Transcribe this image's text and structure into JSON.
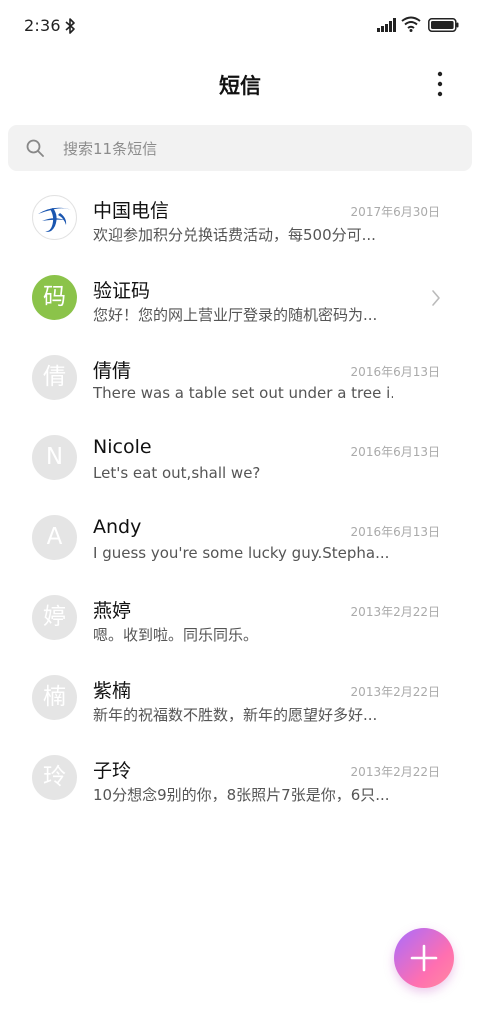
{
  "status_bar": {
    "time": "2:36",
    "icons": [
      "bluetooth-icon",
      "signal-icon",
      "wifi-icon",
      "battery-icon"
    ]
  },
  "header": {
    "title": "短信",
    "menu_icon": "more-vertical-icon"
  },
  "search": {
    "placeholder": "搜索11条短信",
    "icon": "search-icon"
  },
  "conversations": [
    {
      "avatar_type": "china-telecom-logo-icon",
      "avatar_text": "",
      "name": "中国电信",
      "preview": "欢迎参加积分兑换话费活动，每500分可...",
      "date": "2017年6月30日"
    },
    {
      "avatar_type": "text",
      "avatar_text": "码",
      "avatar_color": "#8bc34a",
      "name": "验证码",
      "preview": "您好！您的网上营业厅登录的随机密码为...",
      "date": "",
      "trailing_icon": "chevron-right-icon"
    },
    {
      "avatar_type": "text",
      "avatar_text": "倩",
      "name": "倩倩",
      "preview": "There was a table set out under a tree i...",
      "date": "2016年6月13日"
    },
    {
      "avatar_type": "text",
      "avatar_text": "N",
      "name": "Nicole",
      "preview": "Let's eat out,shall we?",
      "date": "2016年6月13日"
    },
    {
      "avatar_type": "text",
      "avatar_text": "A",
      "name": "Andy",
      "preview": "I guess you're some lucky guy.Stepha...",
      "date": "2016年6月13日"
    },
    {
      "avatar_type": "text",
      "avatar_text": "婷",
      "name": "燕婷",
      "preview": "嗯。收到啦。同乐同乐。",
      "date": "2013年2月22日"
    },
    {
      "avatar_type": "text",
      "avatar_text": "楠",
      "name": "紫楠",
      "preview": "新年的祝福数不胜数，新年的愿望好多好...",
      "date": "2013年2月22日"
    },
    {
      "avatar_type": "text",
      "avatar_text": "玲",
      "name": "子玲",
      "preview": "10分想念9别的你，8张照片7张是你，6只...",
      "date": "2013年2月22日"
    }
  ],
  "fab": {
    "icon": "plus-icon",
    "gradient": [
      "#a86cff",
      "#ff6fb0"
    ]
  },
  "colors": {
    "avatar_default": "#e5e5e5",
    "avatar_green": "#8bc34a",
    "search_bg": "#f2f2f2"
  }
}
